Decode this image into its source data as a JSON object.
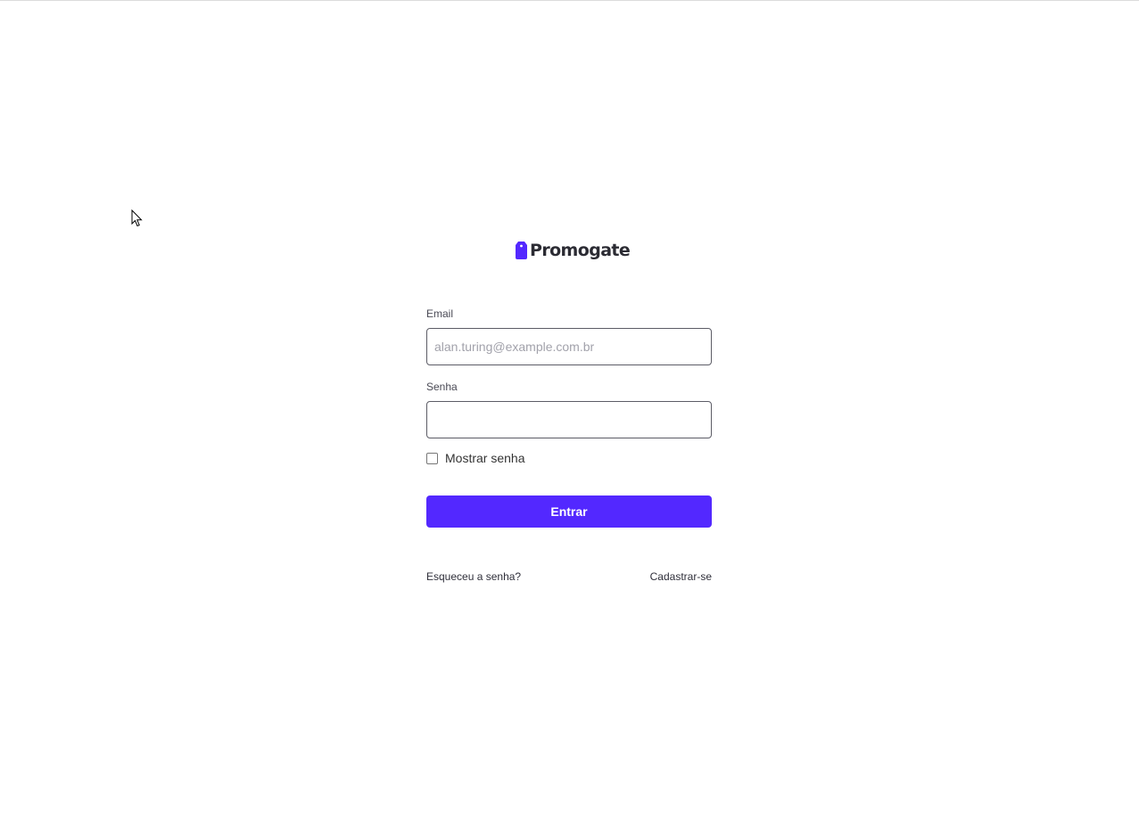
{
  "brand": {
    "name": "Promogate",
    "accent_color": "#5328ff",
    "logo_icon": "price-tag-icon"
  },
  "login_form": {
    "email": {
      "label": "Email",
      "placeholder": "alan.turing@example.com.br",
      "value": ""
    },
    "password": {
      "label": "Senha",
      "value": ""
    },
    "show_password": {
      "label": "Mostrar senha",
      "checked": false
    },
    "submit_label": "Entrar",
    "forgot_password_label": "Esqueceu a senha?",
    "signup_label": "Cadastrar-se"
  },
  "mouse_cursor": "arrow-cursor-icon"
}
